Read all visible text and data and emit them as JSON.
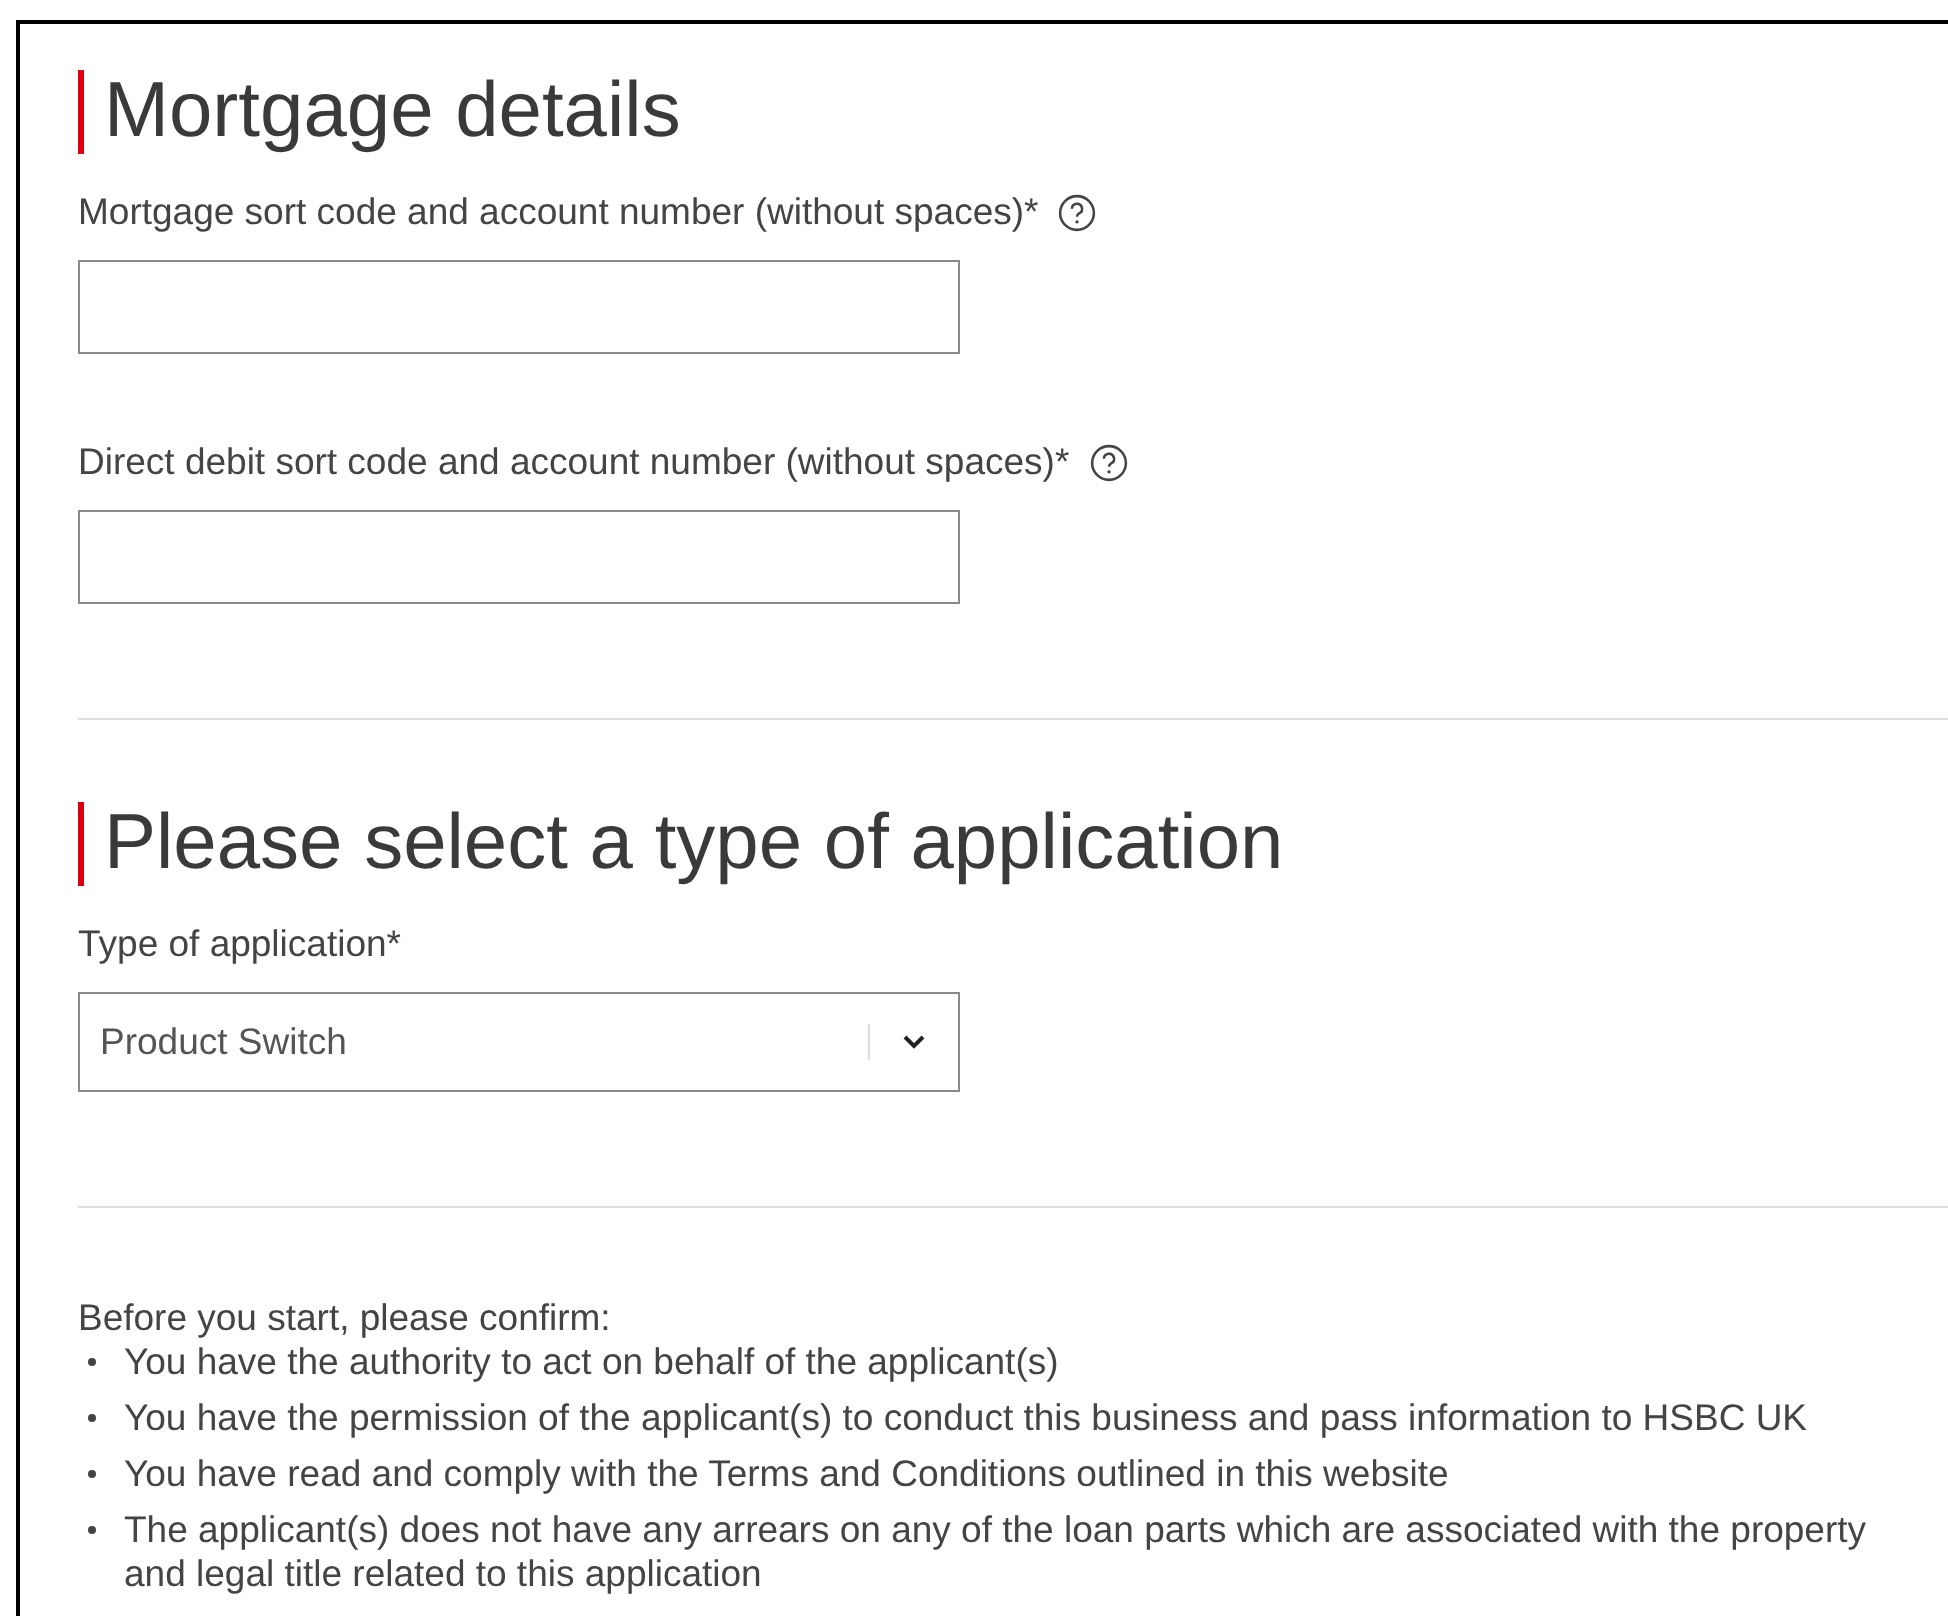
{
  "sections": [
    {
      "heading": "Mortgage details",
      "fields": [
        {
          "kind": "text",
          "label": "Mortgage sort code and account number (without spaces)*",
          "help": true
        },
        {
          "kind": "text",
          "label": "Direct debit sort code and account number (without spaces)*",
          "help": true
        }
      ]
    },
    {
      "heading": "Please select a type of application",
      "fields": [
        {
          "kind": "select",
          "label": "Type of application*",
          "help": false,
          "value": "Product Switch"
        }
      ]
    }
  ],
  "confirmation": {
    "intro": "Before you start, please confirm:",
    "items": [
      "You have the authority to act on behalf of the applicant(s)",
      "You have the permission of the applicant(s) to conduct this business and pass information to HSBC UK",
      "You have read and comply with the Terms and Conditions outlined in this website",
      "The applicant(s) does not have any arrears on any of the loan parts which are associated with the property and legal title related to this application"
    ]
  }
}
